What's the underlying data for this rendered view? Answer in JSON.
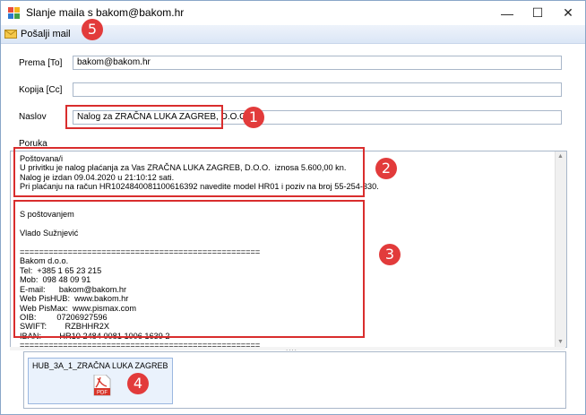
{
  "window": {
    "title": "Slanje maila s bakom@bakom.hr",
    "controls": {
      "minimize": "—",
      "maximize": "☐",
      "close": "✕"
    }
  },
  "toolbar": {
    "send_label": "Pošalji mail"
  },
  "form": {
    "to_label": "Prema [To]",
    "to_value": "bakom@bakom.hr",
    "cc_label": "Kopija [Cc]",
    "cc_value": "",
    "subject_label": "Naslov",
    "subject_value": "Nalog za ZRAČNA LUKA ZAGREB, D.O.O.",
    "message_label": "Poruka"
  },
  "message": {
    "text": "Poštovana/i\nU privitku je nalog plaćanja za Vas ZRAČNA LUKA ZAGREB, D.O.O.  iznosa 5.600,00 kn.\nNalog je izdan 09.04.2020 u 21:10:12 sati.\nPri plaćanju na račun HR1024840081100616392 navedite model HR01 i poziv na broj 55-254-330.\n\n\nS poštovanjem\n\nVlado Sužnjević\n\n==================================================\nBakom d.o.o.\nTel:  +385 1 65 23 215\nMob:  098 48 09 91\nE-mail:      bakom@bakom.hr\nWeb PisHUB:  www.bakom.hr\nWeb PisMax:  www.pismax.com\nOIB:         07206927596\nSWIFT:        RZBHHR2X\nIBAN:        HR10 2484 0081 1006 1639 2\n=================================================="
  },
  "attachment": {
    "name": "HUB_3A_1_ZRAČNA LUKA ZAGREB, ...",
    "icon_text": "PDF"
  },
  "callouts": {
    "c1": "1",
    "c2": "2",
    "c3": "3",
    "c4": "4",
    "c5": "5"
  },
  "colors": {
    "callout_red": "#e23b3b",
    "toolbar_blue": "#dbe6f6"
  }
}
